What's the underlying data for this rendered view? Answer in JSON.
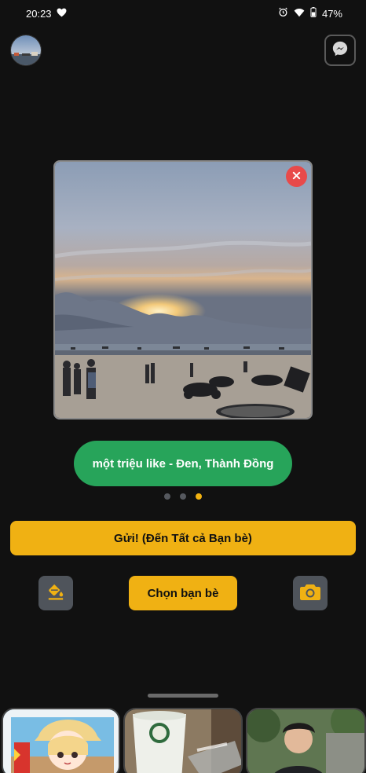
{
  "status_bar": {
    "time": "20:23",
    "battery_percent": "47%",
    "icons": [
      "heart-icon",
      "alarm-icon",
      "wifi-icon",
      "battery-icon"
    ]
  },
  "header": {
    "avatar": "profile-avatar",
    "messenger_icon": "messenger-icon"
  },
  "photo": {
    "description_icon": "sunset-beach-photo",
    "close_icon": "close-icon"
  },
  "music": {
    "label": "một triệu like - Đen, Thành Đồng"
  },
  "pager": {
    "count": 3,
    "active_index": 2
  },
  "actions": {
    "send_all_label": "Gửi! (Đến Tất cả Bạn bè)",
    "choose_friends_label": "Chọn bạn bè",
    "paint_icon": "paint-bucket-icon",
    "camera_icon": "camera-icon"
  },
  "recent_thumbs": [
    "thumb-drawing",
    "thumb-coffee",
    "thumb-person"
  ],
  "colors": {
    "background": "#111111",
    "accent_yellow": "#f0b113",
    "music_green": "#27a45a",
    "close_red": "#e84a4a",
    "icon_button_gray": "#4f545b"
  }
}
